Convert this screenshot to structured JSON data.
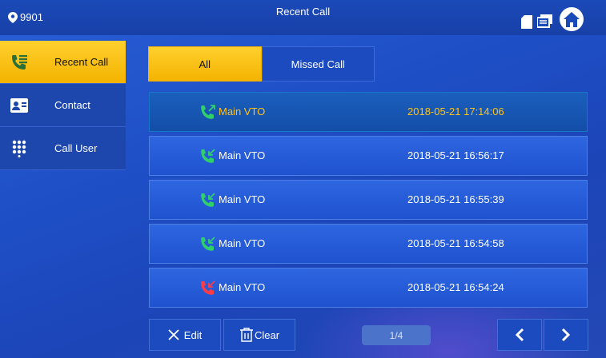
{
  "header": {
    "location_number": "9901",
    "title": "Recent Call"
  },
  "icons": {
    "location": "map-pin-icon",
    "sd_card": "sd-card-icon",
    "messages": "message-icon",
    "home": "home-icon"
  },
  "sidebar": {
    "items": [
      {
        "label": "Recent Call",
        "icon": "call-log-icon",
        "active": true
      },
      {
        "label": "Contact",
        "icon": "contact-card-icon",
        "active": false
      },
      {
        "label": "Call User",
        "icon": "dialpad-icon",
        "active": false
      }
    ]
  },
  "tabs": [
    {
      "label": "All",
      "active": true
    },
    {
      "label": "Missed Call",
      "active": false
    }
  ],
  "calls": [
    {
      "name": "Main VTO",
      "time": "2018-05-21 17:14:06",
      "type": "outgoing",
      "selected": true
    },
    {
      "name": "Main VTO",
      "time": "2018-05-21 16:56:17",
      "type": "incoming",
      "selected": false
    },
    {
      "name": "Main VTO",
      "time": "2018-05-21 16:55:39",
      "type": "incoming",
      "selected": false
    },
    {
      "name": "Main VTO",
      "time": "2018-05-21 16:54:58",
      "type": "incoming",
      "selected": false
    },
    {
      "name": "Main VTO",
      "time": "2018-05-21 16:54:24",
      "type": "missed",
      "selected": false
    }
  ],
  "toolbar": {
    "edit_label": "Edit",
    "clear_label": "Clear",
    "page_indicator": "1/4"
  },
  "colors": {
    "accent": "#f4b300",
    "call_green": "#2fd06a",
    "call_missed": "#ff3b46",
    "selected_text": "#ffc21a"
  }
}
